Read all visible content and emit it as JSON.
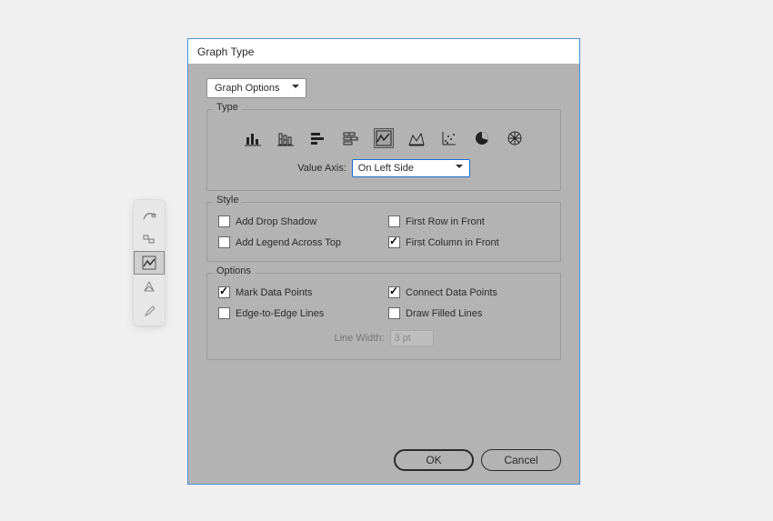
{
  "dialog_title": "Graph Type",
  "main_dropdown": "Graph Options",
  "type_group_label": "Type",
  "value_axis_label": "Value Axis:",
  "value_axis_value": "On Left Side",
  "style_group_label": "Style",
  "style_checks": {
    "drop_shadow": "Add Drop Shadow",
    "first_row_front": "First Row in Front",
    "legend_across": "Add Legend Across Top",
    "first_col_front": "First Column in Front"
  },
  "options_group_label": "Options",
  "options_checks": {
    "mark_points": "Mark Data Points",
    "connect_points": "Connect Data Points",
    "edge_lines": "Edge-to-Edge Lines",
    "filled_lines": "Draw Filled Lines"
  },
  "line_width_label": "Line Width:",
  "line_width_value": "3 pt",
  "buttons": {
    "ok": "OK",
    "cancel": "Cancel"
  }
}
